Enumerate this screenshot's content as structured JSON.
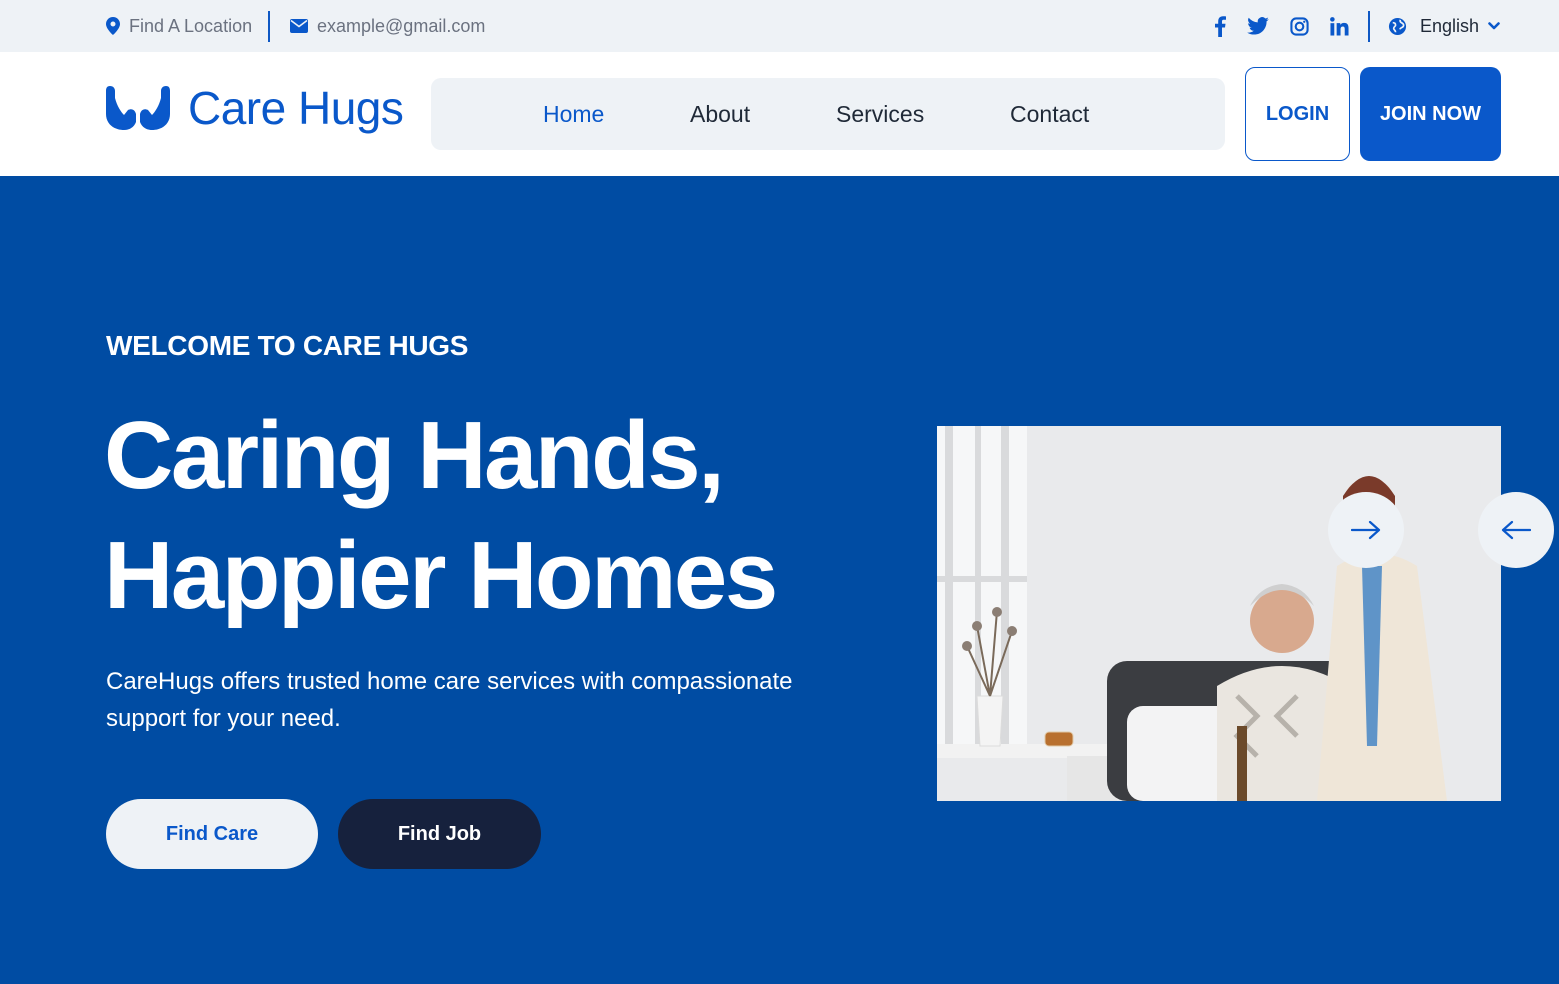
{
  "topbar": {
    "location": "Find A Location",
    "email": "example@gmail.com",
    "socials": [
      "facebook-icon",
      "twitter-icon",
      "instagram-icon",
      "linkedin-icon"
    ],
    "language": "English"
  },
  "header": {
    "brand": "Care Hugs",
    "nav": [
      "Home",
      "About",
      "Services",
      "Contact"
    ],
    "active_nav": "Home",
    "login": "LOGIN",
    "join": "JOIN NOW"
  },
  "hero": {
    "eyebrow": "WELCOME TO CARE HUGS",
    "headline_line1": "Caring Hands,",
    "headline_line2": "Happier Homes",
    "description": "CareHugs offers trusted home care services with compassionate support for your need.",
    "primary_button": "Find Care",
    "secondary_button": "Find Job"
  },
  "colors": {
    "brand_blue": "#0a58ca",
    "hero_bg": "#004ca3",
    "dark_button": "#16213d",
    "light_bg": "#eef2f6"
  }
}
